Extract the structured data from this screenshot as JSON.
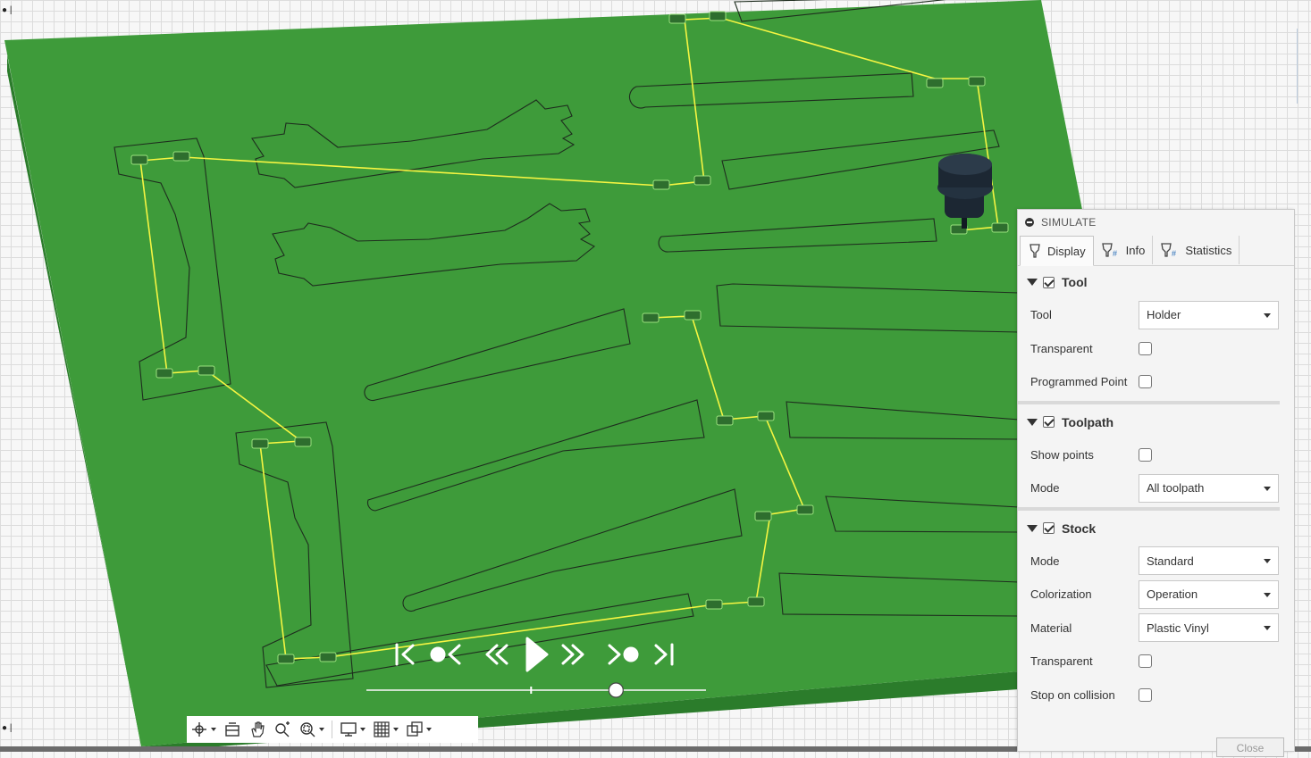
{
  "simulate": {
    "title": "SIMULATE",
    "tabs": [
      {
        "label": "Display",
        "active": true
      },
      {
        "label": "Info",
        "active": false
      },
      {
        "label": "Statistics",
        "active": false
      }
    ],
    "sections": {
      "tool": {
        "title": "Tool",
        "checked": true,
        "tool_label": "Tool",
        "tool_value": "Holder",
        "transparent_label": "Transparent",
        "transparent_checked": false,
        "programmed_point_label": "Programmed Point",
        "programmed_point_checked": false
      },
      "toolpath": {
        "title": "Toolpath",
        "checked": true,
        "show_points_label": "Show points",
        "show_points_checked": false,
        "mode_label": "Mode",
        "mode_value": "All toolpath"
      },
      "stock": {
        "title": "Stock",
        "checked": true,
        "mode_label": "Mode",
        "mode_value": "Standard",
        "colorization_label": "Colorization",
        "colorization_value": "Operation",
        "material_label": "Material",
        "material_value": "Plastic Vinyl",
        "transparent_label": "Transparent",
        "transparent_checked": false,
        "stop_on_collision_label": "Stop on collision",
        "stop_on_collision_checked": false
      }
    },
    "close_label": "Close"
  },
  "playback": {
    "icons": [
      "skip-to-start-icon",
      "previous-operation-icon",
      "step-back-icon",
      "play-icon",
      "step-forward-icon",
      "next-operation-icon",
      "skip-to-end-icon"
    ],
    "progress": 0.735,
    "marker": 0.485
  },
  "toolbar": {
    "icons": [
      "orbit-icon",
      "look-at-icon",
      "pan-icon",
      "zoom-icon",
      "fit-icon",
      "display-settings-icon",
      "grid-settings-icon",
      "viewports-icon"
    ]
  },
  "colors": {
    "stock_green": "#3e9b3a",
    "stock_side": "#2a7a2a",
    "toolpath_yellow": "#f5f542",
    "tool_holder": "#1c2733",
    "panel_bg": "#f4f4f4"
  }
}
